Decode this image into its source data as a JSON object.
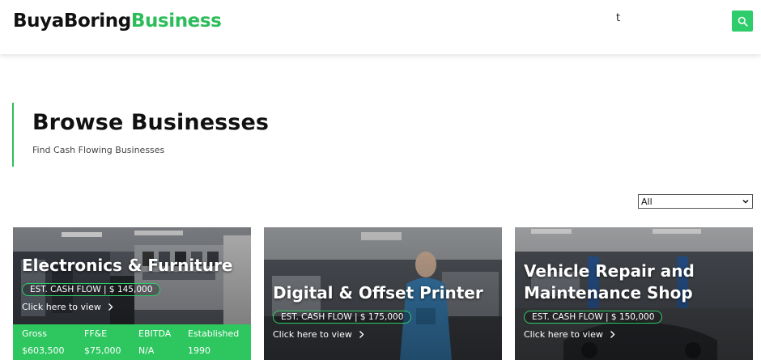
{
  "header": {
    "logo_part1": "BuyaBoring",
    "logo_part2": "Business",
    "stray_text": "t"
  },
  "hero": {
    "title": "Browse Businesses",
    "subtitle": "Find Cash Flowing Businesses"
  },
  "filter": {
    "selected": "All"
  },
  "cards": [
    {
      "title": "Electronics & Furniture",
      "cash_flow": "EST. CASH FLOW | $ 145,000",
      "link": "Click here to view",
      "stats": {
        "headers": [
          "Gross",
          "FF&E",
          "EBITDA",
          "Established"
        ],
        "values": [
          "$603,500",
          "$75,000",
          "N/A",
          "1990"
        ]
      }
    },
    {
      "title": "Digital & Offset Printer",
      "cash_flow": "EST. CASH FLOW | $ 175,000",
      "link": "Click here to view"
    },
    {
      "title_line1": "Vehicle Repair and",
      "title_line2": "Maintenance Shop",
      "cash_flow": "EST. CASH FLOW | $ 150,000",
      "link": "Click here to view"
    }
  ],
  "colors": {
    "brand_green": "#2cbd5a",
    "stats_green": "#2dc65f"
  },
  "icons": [
    "search-icon",
    "chevron-down-icon",
    "chevron-right-icon"
  ]
}
